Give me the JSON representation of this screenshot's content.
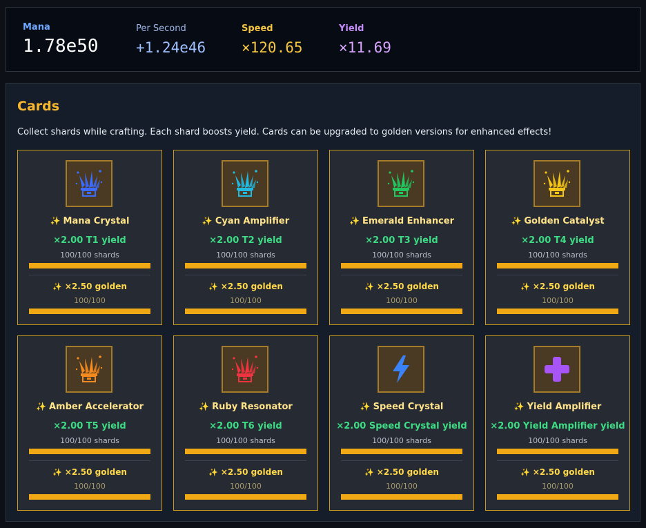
{
  "stats": {
    "mana": {
      "label": "Mana",
      "value": "1.78e50"
    },
    "per_second": {
      "label": "Per Second",
      "value": "+1.24e46"
    },
    "speed": {
      "label": "Speed",
      "value": "×120.65"
    },
    "yield": {
      "label": "Yield",
      "value": "×11.69"
    }
  },
  "cards_panel": {
    "title": "Cards",
    "description": "Collect shards while crafting. Each shard boosts yield. Cards can be upgraded to golden versions for enhanced effects!"
  },
  "cards": [
    {
      "name": "Mana Crystal",
      "icon": "crystal-icon",
      "color": "#3b6cff",
      "yield": "×2.00 T1 yield",
      "shards": "100/100 shards",
      "shard_progress": 1.0,
      "golden": "×2.50 golden",
      "golden_count": "100/100",
      "golden_progress": 1.0
    },
    {
      "name": "Cyan Amplifier",
      "icon": "crystal-icon",
      "color": "#22b8e0",
      "yield": "×2.00 T2 yield",
      "shards": "100/100 shards",
      "shard_progress": 1.0,
      "golden": "×2.50 golden",
      "golden_count": "100/100",
      "golden_progress": 1.0
    },
    {
      "name": "Emerald Enhancer",
      "icon": "crystal-icon",
      "color": "#22c55e",
      "yield": "×2.00 T3 yield",
      "shards": "100/100 shards",
      "shard_progress": 1.0,
      "golden": "×2.50 golden",
      "golden_count": "100/100",
      "golden_progress": 1.0
    },
    {
      "name": "Golden Catalyst",
      "icon": "crystal-icon",
      "color": "#f5c518",
      "yield": "×2.00 T4 yield",
      "shards": "100/100 shards",
      "shard_progress": 1.0,
      "golden": "×2.50 golden",
      "golden_count": "100/100",
      "golden_progress": 1.0
    },
    {
      "name": "Amber Accelerator",
      "icon": "crystal-icon",
      "color": "#f58a1f",
      "yield": "×2.00 T5 yield",
      "shards": "100/100 shards",
      "shard_progress": 1.0,
      "golden": "×2.50 golden",
      "golden_count": "100/100",
      "golden_progress": 1.0
    },
    {
      "name": "Ruby Resonator",
      "icon": "crystal-icon",
      "color": "#ef3340",
      "yield": "×2.00 T6 yield",
      "shards": "100/100 shards",
      "shard_progress": 1.0,
      "golden": "×2.50 golden",
      "golden_count": "100/100",
      "golden_progress": 1.0
    },
    {
      "name": "Speed Crystal",
      "icon": "lightning-icon",
      "color": "#3b82f6",
      "yield": "×2.00 Speed Crystal yield",
      "shards": "100/100 shards",
      "shard_progress": 1.0,
      "golden": "×2.50 golden",
      "golden_count": "100/100",
      "golden_progress": 1.0
    },
    {
      "name": "Yield Amplifier",
      "icon": "plus-icon",
      "color": "#a855f7",
      "yield": "×2.00 Yield Amplifier yield",
      "shards": "100/100 shards",
      "shard_progress": 1.0,
      "golden": "×2.50 golden",
      "golden_count": "100/100",
      "golden_progress": 1.0
    }
  ]
}
